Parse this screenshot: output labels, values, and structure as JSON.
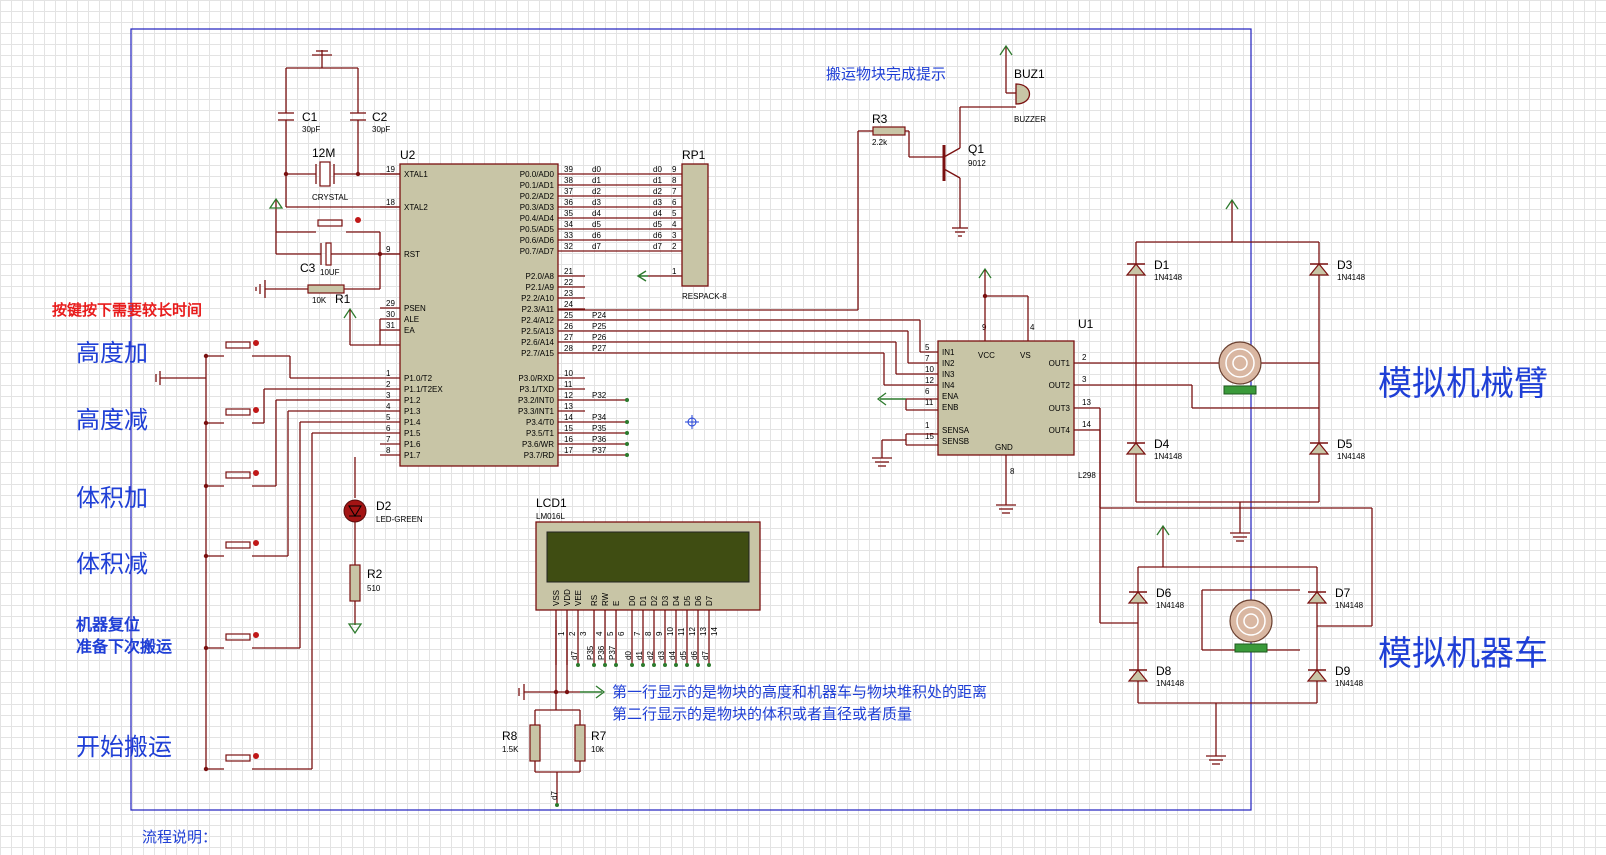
{
  "notes": {
    "key_hint": "按键按下需要较长时间",
    "buzzer_hint": "搬运物块完成提示",
    "lcd_line1": "第一行显示的是物块的高度和机器车与物块堆积处的距离",
    "lcd_line2": "第二行显示的是物块的体积或者直径或者质量",
    "flow": "流程说明："
  },
  "buttons": [
    {
      "label": "高度加"
    },
    {
      "label": "高度减"
    },
    {
      "label": "体积加"
    },
    {
      "label": "体积减"
    },
    {
      "label_line1": "机器复位",
      "label_line2": "准备下次搬运"
    },
    {
      "label": "开始搬运"
    }
  ],
  "big_labels": {
    "arm": "模拟机械臂",
    "car": "模拟机器车"
  },
  "mcu": {
    "ref": "U2",
    "left_pins": [
      {
        "num": "19",
        "name": "XTAL1"
      },
      {
        "num": "18",
        "name": "XTAL2"
      },
      {
        "num": "9",
        "name": "RST"
      },
      {
        "num": "29",
        "name": "PSEN"
      },
      {
        "num": "30",
        "name": "ALE"
      },
      {
        "num": "31",
        "name": "EA"
      },
      {
        "num": "1",
        "name": "P1.0/T2"
      },
      {
        "num": "2",
        "name": "P1.1/T2EX"
      },
      {
        "num": "3",
        "name": "P1.2"
      },
      {
        "num": "4",
        "name": "P1.3"
      },
      {
        "num": "5",
        "name": "P1.4"
      },
      {
        "num": "6",
        "name": "P1.5"
      },
      {
        "num": "7",
        "name": "P1.6"
      },
      {
        "num": "8",
        "name": "P1.7"
      }
    ],
    "right_pins": [
      {
        "num": "39",
        "name": "P0.0/AD0",
        "net": "d0"
      },
      {
        "num": "38",
        "name": "P0.1/AD1",
        "net": "d1"
      },
      {
        "num": "37",
        "name": "P0.2/AD2",
        "net": "d2"
      },
      {
        "num": "36",
        "name": "P0.3/AD3",
        "net": "d3"
      },
      {
        "num": "35",
        "name": "P0.4/AD4",
        "net": "d4"
      },
      {
        "num": "34",
        "name": "P0.5/AD5",
        "net": "d5"
      },
      {
        "num": "33",
        "name": "P0.6/AD6",
        "net": "d6"
      },
      {
        "num": "32",
        "name": "P0.7/AD7",
        "net": "d7"
      },
      {
        "num": "21",
        "name": "P2.0/A8",
        "net": ""
      },
      {
        "num": "22",
        "name": "P2.1/A9",
        "net": ""
      },
      {
        "num": "23",
        "name": "P2.2/A10",
        "net": ""
      },
      {
        "num": "24",
        "name": "P2.3/A11",
        "net": ""
      },
      {
        "num": "25",
        "name": "P2.4/A12",
        "net": "P24"
      },
      {
        "num": "26",
        "name": "P2.5/A13",
        "net": "P25"
      },
      {
        "num": "27",
        "name": "P2.6/A14",
        "net": "P26"
      },
      {
        "num": "28",
        "name": "P2.7/A15",
        "net": "P27"
      },
      {
        "num": "10",
        "name": "P3.0/RXD",
        "net": ""
      },
      {
        "num": "11",
        "name": "P3.1/TXD",
        "net": ""
      },
      {
        "num": "12",
        "name": "P3.2/INT0",
        "net": "P32"
      },
      {
        "num": "13",
        "name": "P3.3/INT1",
        "net": ""
      },
      {
        "num": "14",
        "name": "P3.4/T0",
        "net": "P34"
      },
      {
        "num": "15",
        "name": "P3.5/T1",
        "net": "P35"
      },
      {
        "num": "16",
        "name": "P3.6/WR",
        "net": "P36"
      },
      {
        "num": "17",
        "name": "P3.7/RD",
        "net": "P37"
      }
    ]
  },
  "rp1": {
    "ref": "RP1",
    "type": "RESPACK-8",
    "pins": [
      "9",
      "8",
      "7",
      "6",
      "5",
      "4",
      "3",
      "2",
      "1"
    ]
  },
  "crystal": {
    "ref": "12M",
    "type": "CRYSTAL"
  },
  "c1": {
    "ref": "C1",
    "value": "30pF"
  },
  "c2": {
    "ref": "C2",
    "value": "30pF"
  },
  "c3": {
    "ref": "C3",
    "value": "10UF"
  },
  "r1": {
    "ref": "R1",
    "value": "10K"
  },
  "r2": {
    "ref": "R2",
    "value": "510"
  },
  "r3": {
    "ref": "R3",
    "value": "2.2k"
  },
  "r7": {
    "ref": "R7",
    "value": "10k"
  },
  "r8": {
    "ref": "R8",
    "value": "1.5K"
  },
  "d2": {
    "ref": "D2",
    "type": "LED-GREEN"
  },
  "q1": {
    "ref": "Q1",
    "type": "9012"
  },
  "buz": {
    "ref": "BUZ1",
    "type": "BUZZER"
  },
  "lcd": {
    "ref": "LCD1",
    "type": "LM016L",
    "pins": [
      "VSS",
      "VDD",
      "VEE",
      "RS",
      "RW",
      "E",
      "D0",
      "D1",
      "D2",
      "D3",
      "D4",
      "D5",
      "D6",
      "D7"
    ],
    "nums": [
      "1",
      "2",
      "3",
      "4",
      "5",
      "6",
      "7",
      "8",
      "9",
      "10",
      "11",
      "12",
      "13",
      "14"
    ],
    "nets": [
      "",
      "",
      "d7",
      "P35",
      "P36",
      "P37",
      "d0",
      "d1",
      "d2",
      "d3",
      "d4",
      "d5",
      "d6",
      "d7"
    ]
  },
  "l298": {
    "ref": "U1",
    "type": "L298",
    "left_pins": [
      {
        "num": "5",
        "name": "IN1"
      },
      {
        "num": "7",
        "name": "IN2"
      },
      {
        "num": "10",
        "name": "IN3"
      },
      {
        "num": "12",
        "name": "IN4"
      },
      {
        "num": "6",
        "name": "ENA"
      },
      {
        "num": "11",
        "name": "ENB"
      },
      {
        "num": "1",
        "name": "SENSA"
      },
      {
        "num": "15",
        "name": "SENSB"
      }
    ],
    "right_pins": [
      {
        "num": "2",
        "name": "OUT1"
      },
      {
        "num": "3",
        "name": "OUT2"
      },
      {
        "num": "13",
        "name": "OUT3"
      },
      {
        "num": "14",
        "name": "OUT4"
      }
    ],
    "top_pins": [
      {
        "num": "9",
        "name": "VCC"
      },
      {
        "num": "4",
        "name": "VS"
      }
    ],
    "bottom_pin": {
      "num": "8",
      "name": "GND"
    }
  },
  "diodes": [
    {
      "ref": "D1",
      "type": "1N4148"
    },
    {
      "ref": "D3",
      "type": "1N4148"
    },
    {
      "ref": "D4",
      "type": "1N4148"
    },
    {
      "ref": "D5",
      "type": "1N4148"
    },
    {
      "ref": "D6",
      "type": "1N4148"
    },
    {
      "ref": "D7",
      "type": "1N4148"
    },
    {
      "ref": "D8",
      "type": "1N4148"
    },
    {
      "ref": "D9",
      "type": "1N4148"
    }
  ],
  "net_d7": "d7"
}
